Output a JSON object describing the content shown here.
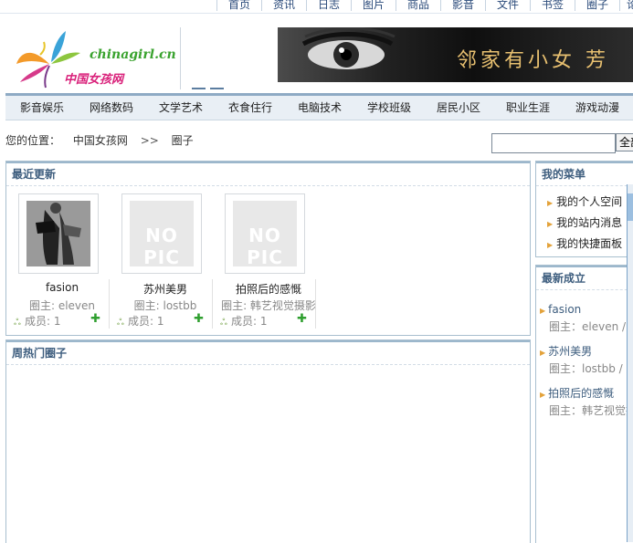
{
  "topnav": [
    "首页",
    "资讯",
    "日志",
    "图片",
    "商品",
    "影音",
    "文件",
    "书签",
    "圈子",
    "论"
  ],
  "logo": {
    "en": "chinagirl.cn",
    "cn": "中国女孩网"
  },
  "banner_text": "邻家有小女 芳",
  "categories": [
    "影音娱乐",
    "网络数码",
    "文学艺术",
    "衣食住行",
    "电脑技术",
    "学校班级",
    "居民小区",
    "职业生涯",
    "游戏动漫"
  ],
  "breadcrumb": {
    "label": "您的位置：",
    "home": "中国女孩网",
    "sep": ">>",
    "current": "圈子"
  },
  "search": {
    "value": "",
    "button": "全部"
  },
  "recent": {
    "title": "最近更新",
    "items": [
      {
        "name": "fasion",
        "owner": "圈主: eleven",
        "members": "成员: 1"
      },
      {
        "name": "苏州美男",
        "owner": "圈主: lostbb",
        "members": "成员: 1",
        "pic": "NO PIC"
      },
      {
        "name": "拍照后的感慨",
        "owner": "圈主: 韩艺视觉摄影",
        "members": "成员: 1",
        "pic": "NO PIC"
      }
    ]
  },
  "hot": {
    "title": "周热门圈子"
  },
  "mymenu": {
    "title": "我的菜单",
    "items": [
      "我的个人空间",
      "我的站内消息",
      "我的快捷面板"
    ]
  },
  "newest": {
    "title": "最新成立",
    "items": [
      {
        "name": "fasion",
        "sub": "圈主：eleven / 成"
      },
      {
        "name": "苏州美男",
        "sub": "圈主：lostbb / 成"
      },
      {
        "name": "拍照后的感慨",
        "sub": "圈主：韩艺视觉摄"
      }
    ]
  }
}
